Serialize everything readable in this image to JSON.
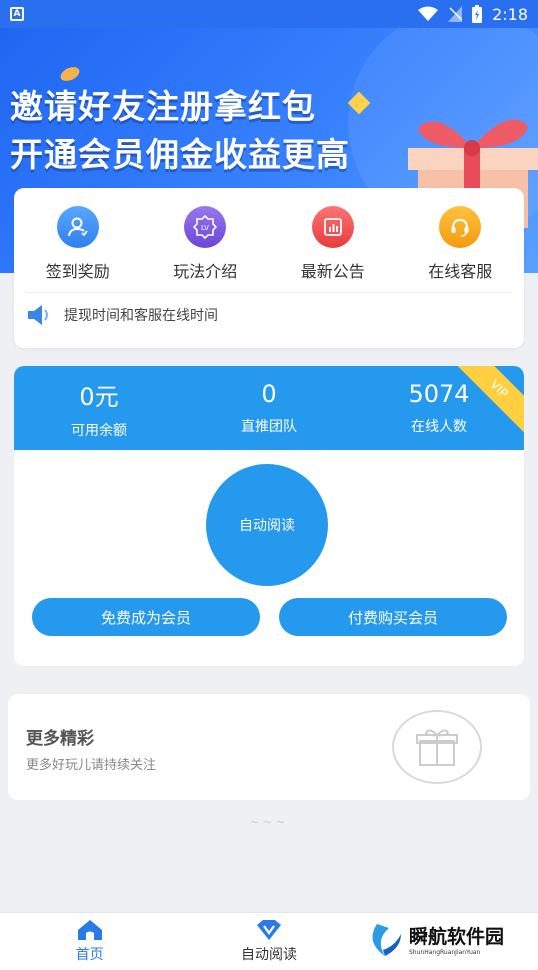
{
  "status_bar": {
    "app_badge": "A",
    "time": "2:18"
  },
  "banner": {
    "line1": "邀请好友注册拿红包",
    "line2": "开通会员佣金收益更高"
  },
  "menu": [
    {
      "label": "签到奖励",
      "color": "#3b8ff2",
      "icon": "user-heart-icon"
    },
    {
      "label": "玩法介绍",
      "color": "#7a56e0",
      "icon": "lv-badge-icon"
    },
    {
      "label": "最新公告",
      "color": "#ef4f4f",
      "icon": "chart-icon"
    },
    {
      "label": "在线客服",
      "color": "#f6a517",
      "icon": "headset-icon"
    }
  ],
  "notice": {
    "text": "提现时间和客服在线时间",
    "icon": "speaker-icon"
  },
  "stats": [
    {
      "value": "0元",
      "label": "可用余额"
    },
    {
      "value": "0",
      "label": "直推团队"
    },
    {
      "value": "5074",
      "label": "在线人数"
    }
  ],
  "vip_ribbon": "VIP",
  "auto_read_label": "自动阅读",
  "buttons": {
    "free": "免费成为会员",
    "paid": "付费购买会员"
  },
  "more": {
    "title": "更多精彩",
    "subtitle": "更多好玩儿请持续关注"
  },
  "divider": "~~~",
  "tabs": [
    {
      "label": "首页",
      "active": true
    },
    {
      "label": "自动阅读",
      "active": false
    }
  ],
  "watermark": {
    "title": "瞬航软件园",
    "sub": "ShunHangRuanJianYuan"
  },
  "colors": {
    "primary": "#2599ee",
    "banner": "#2a6ff0"
  }
}
